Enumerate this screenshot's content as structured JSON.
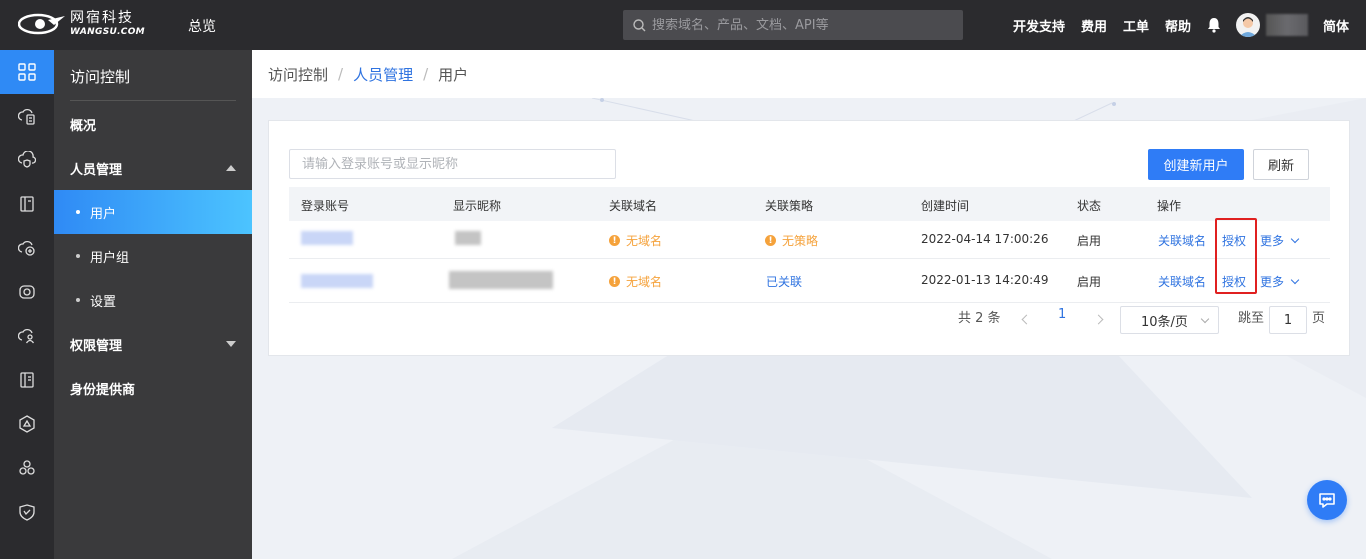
{
  "brand": {
    "name_cn": "网宿科技",
    "name_en": "WANGSU.COM"
  },
  "topbar": {
    "overview": "总览",
    "search_placeholder": "搜索域名、产品、文档、API等",
    "links": [
      "开发支持",
      "费用",
      "工单",
      "帮助"
    ],
    "language": "简体"
  },
  "sidebar": {
    "title": "访问控制",
    "items": [
      {
        "label": "概况"
      },
      {
        "label": "人员管理"
      },
      {
        "label": "用户"
      },
      {
        "label": "用户组"
      },
      {
        "label": "设置"
      },
      {
        "label": "权限管理"
      },
      {
        "label": "身份提供商"
      }
    ]
  },
  "breadcrumb": {
    "root": "访问控制",
    "section": "人员管理",
    "current": "用户",
    "sep": "/"
  },
  "toolbar": {
    "filter_placeholder": "请输入登录账号或显示昵称",
    "create_label": "创建新用户",
    "refresh_label": "刷新"
  },
  "table": {
    "headers": [
      "登录账号",
      "显示昵称",
      "关联域名",
      "关联策略",
      "创建时间",
      "状态",
      "操作"
    ],
    "rows": [
      {
        "domain": "无域名",
        "policy": "无策略",
        "created": "2022-04-14 17:00:26",
        "status": "启用",
        "action_domain": "关联域名",
        "action_auth": "授权",
        "action_more": "更多"
      },
      {
        "domain": "无域名",
        "policy": "已关联",
        "created": "2022-01-13 14:20:49",
        "status": "启用",
        "action_domain": "关联域名",
        "action_auth": "授权",
        "action_more": "更多"
      }
    ]
  },
  "pagination": {
    "total": "共 2 条",
    "current": "1",
    "page_size": "10条/页",
    "jump_label": "跳至",
    "jump_value": "1",
    "page_unit": "页"
  },
  "colors": {
    "accent": "#2f7cf6",
    "warning": "#f5a23b",
    "highlight": "#e02020",
    "topbar": "#2b2b2e"
  }
}
